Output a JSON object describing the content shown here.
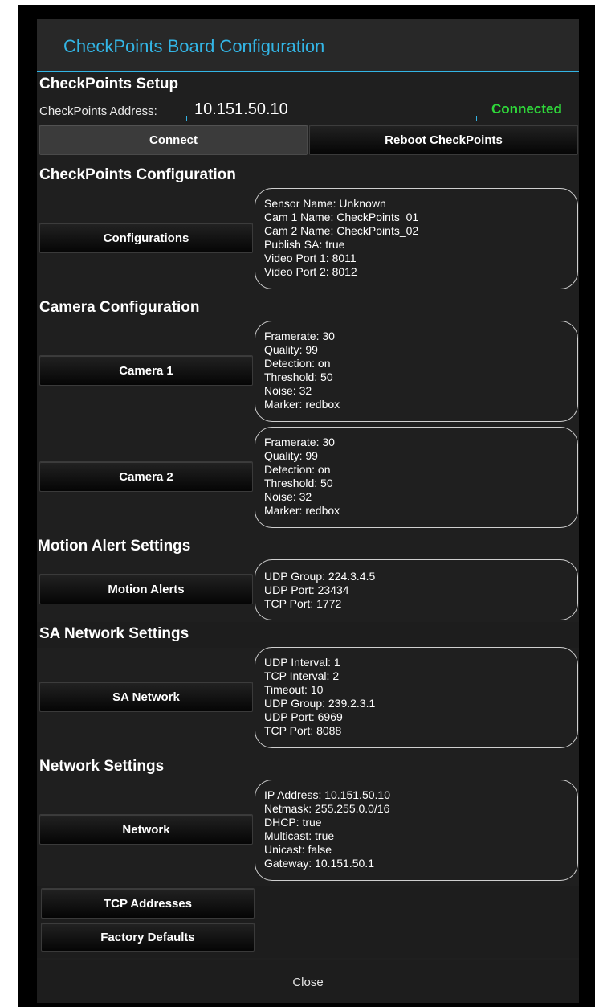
{
  "dialog": {
    "title": "CheckPoints Board Configuration"
  },
  "setup": {
    "heading": "CheckPoints Setup",
    "address_label": "CheckPoints Address:",
    "address_value": "10.151.50.10",
    "status": "Connected",
    "connect_label": "Connect",
    "reboot_label": "Reboot CheckPoints"
  },
  "config": {
    "heading": "CheckPoints Configuration",
    "button_label": "Configurations",
    "info": [
      "Sensor Name: Unknown",
      "Cam 1 Name: CheckPoints_01",
      "Cam 2 Name: CheckPoints_02",
      "Publish SA: true",
      "Video Port 1: 8011",
      "Video Port 2: 8012"
    ]
  },
  "camera": {
    "heading": "Camera Configuration",
    "cam1_label": "Camera 1",
    "cam1_info": [
      "Framerate: 30",
      "Quality: 99",
      "Detection: on",
      "Threshold: 50",
      "Noise: 32",
      "Marker: redbox"
    ],
    "cam2_label": "Camera 2",
    "cam2_info": [
      "Framerate: 30",
      "Quality: 99",
      "Detection: on",
      "Threshold: 50",
      "Noise: 32",
      "Marker: redbox"
    ]
  },
  "motion": {
    "heading": "Motion Alert Settings",
    "button_label": "Motion Alerts",
    "info": [
      "UDP Group: 224.3.4.5",
      "UDP Port: 23434",
      "TCP Port: 1772"
    ]
  },
  "sa_network": {
    "heading": "SA Network Settings",
    "button_label": "SA Network",
    "info": [
      "UDP Interval: 1",
      "TCP Interval: 2",
      "Timeout: 10",
      "UDP Group: 239.2.3.1",
      "UDP Port: 6969",
      "TCP Port: 8088"
    ]
  },
  "network": {
    "heading": "Network Settings",
    "button_label": "Network",
    "info": [
      "IP Address: 10.151.50.10",
      "Netmask: 255.255.0.0/16",
      "DHCP: true",
      "Multicast: true",
      "Unicast: false",
      "Gateway: 10.151.50.1"
    ]
  },
  "extra": {
    "tcp_label": "TCP Addresses",
    "factory_label": "Factory Defaults"
  },
  "footer": {
    "close_label": "Close"
  },
  "colors": {
    "accent": "#33b5e5",
    "connected": "#2fd83a"
  }
}
